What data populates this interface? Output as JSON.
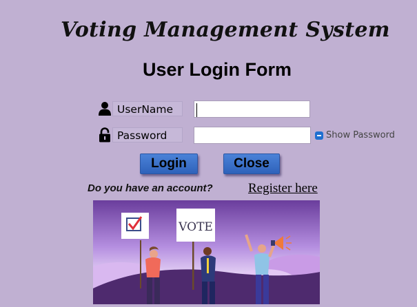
{
  "header": {
    "app_title": "Voting Management System",
    "form_title": "User Login Form"
  },
  "form": {
    "username": {
      "icon": "user-icon",
      "label": "UserName",
      "value": "",
      "placeholder": ""
    },
    "password": {
      "icon": "lock-icon",
      "label": "Password",
      "value": "",
      "placeholder": ""
    },
    "show_password_label": "Show Password"
  },
  "buttons": {
    "login_label": "Login",
    "close_label": "Close"
  },
  "register": {
    "prompt": "Do you have an account?",
    "link_label": "Register here"
  },
  "banner": {
    "sign_text": "VOTE",
    "icon": "voting-rally-illustration"
  },
  "colors": {
    "background": "#c0b0d2",
    "button": "#3a6fca",
    "checkbox": "#1f6fd0"
  }
}
